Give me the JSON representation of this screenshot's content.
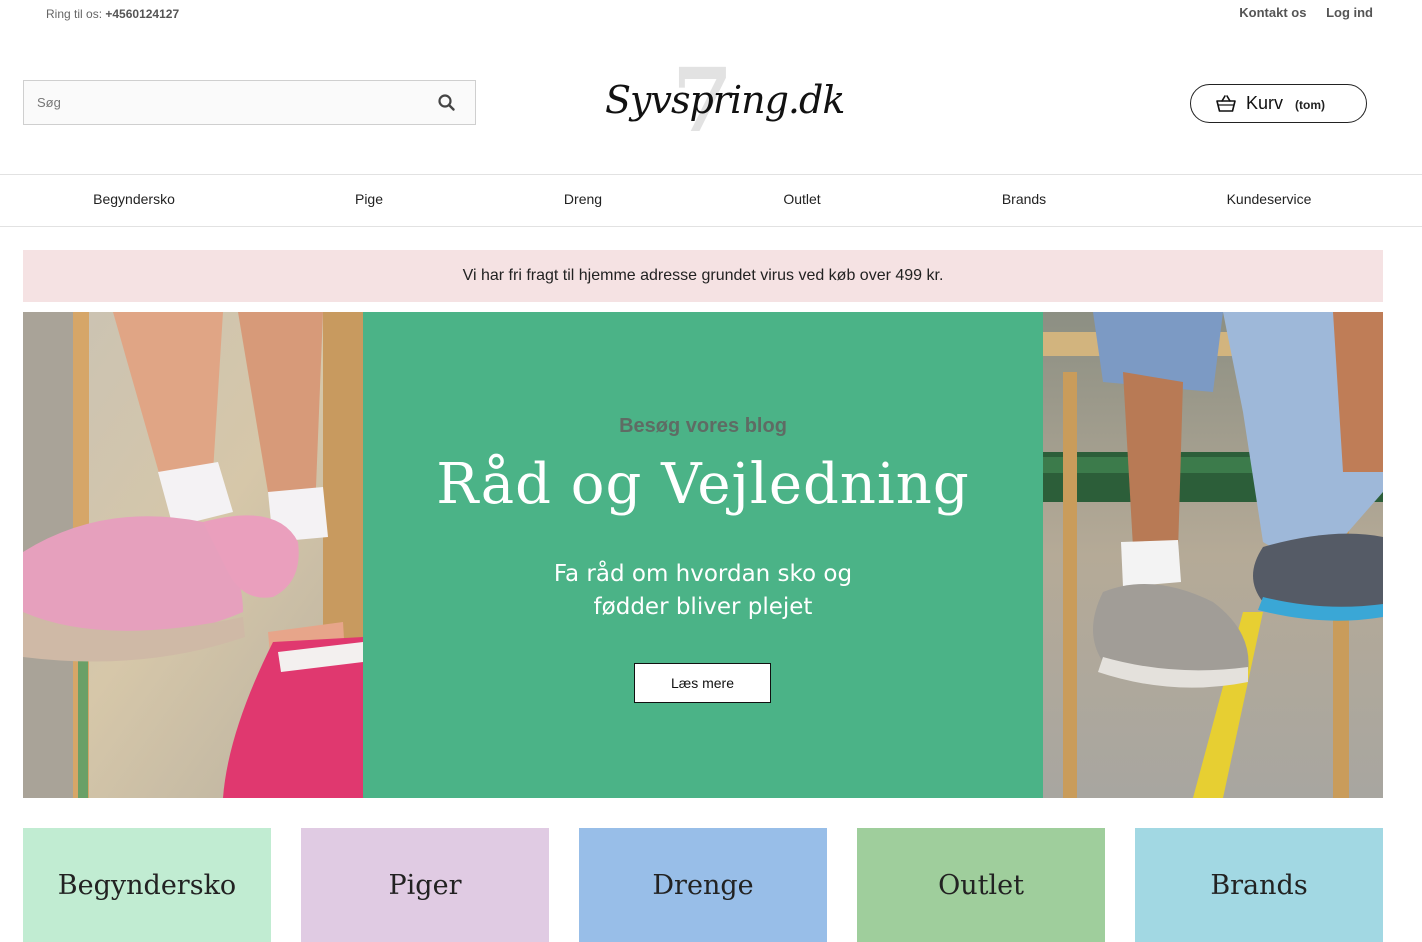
{
  "topbar": {
    "phone_prefix": "Ring til os:",
    "phone_number": "+4560124127",
    "contact_label": "Kontakt os",
    "login_label": "Log ind"
  },
  "header": {
    "search_placeholder": "Søg",
    "logo_text": "Syvspring.dk",
    "logo_numeral": "7",
    "cart_label": "Kurv",
    "cart_count": "(tom)"
  },
  "nav": {
    "items": [
      {
        "label": "Begyndersko"
      },
      {
        "label": "Pige"
      },
      {
        "label": "Dreng"
      },
      {
        "label": "Outlet"
      },
      {
        "label": "Brands"
      },
      {
        "label": "Kundeservice"
      }
    ]
  },
  "notice": {
    "text": "Vi har fri fragt til hjemme adresse grundet virus ved køb over 499 kr."
  },
  "hero": {
    "kicker": "Besøg vores blog",
    "heading": "Råd og Vejledning",
    "subtitle": "Fa råd om hvordan sko og fødder bliver plejet",
    "cta_label": "Læs mere",
    "background_color": "#4bb387"
  },
  "categories": [
    {
      "label": "Begyndersko",
      "color": "#c1ecd2"
    },
    {
      "label": "Piger",
      "color": "#e0cbe3"
    },
    {
      "label": "Drenge",
      "color": "#98bee8"
    },
    {
      "label": "Outlet",
      "color": "#9fce9c"
    },
    {
      "label": "Brands",
      "color": "#a2d8e3"
    }
  ]
}
